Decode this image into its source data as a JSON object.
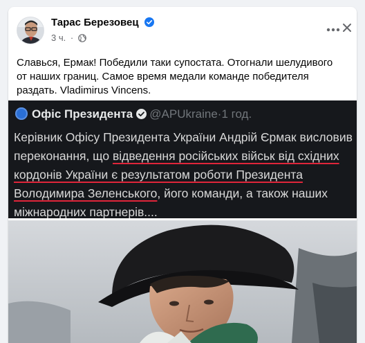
{
  "post": {
    "author": "Тарас Березовец",
    "time": "3 ч.",
    "dot": "·",
    "text": "Славься, Ермак! Победили таки супостата. Отогнали шелудивого от наших границ. Самое время медали команде победителя раздать. Vladimirus Vincens."
  },
  "tweet": {
    "name": "Офіс Президента",
    "handle": "@APUkraine",
    "dot": "·",
    "time": "1 год.",
    "body_part1": "Керівник Офісу Президента України Андрій Єрмак висловив переконання, що ",
    "body_underlined": "відведення російських військ від східних кордонів України є результатом роботи Президента Володимира Зеленського",
    "body_part2": ", його команди, а також наших міжнародних партнерів....",
    "underline_color": "#e0253a"
  },
  "colors": {
    "page_bg": "#f0f2f5",
    "card_bg": "#ffffff",
    "tweet_bg": "#16181c",
    "verified": "#1877f2"
  },
  "icons": [
    "verified-badge-icon",
    "globe-icon",
    "more-options-icon",
    "close-icon",
    "tweet-verified-icon"
  ]
}
